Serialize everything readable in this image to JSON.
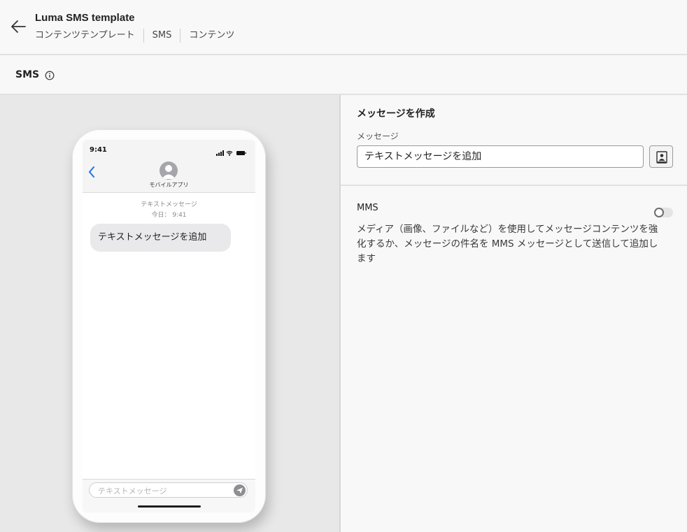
{
  "header": {
    "title": "Luma SMS template",
    "breadcrumbs": [
      "コンテンツテンプレート",
      "SMS",
      "コンテンツ"
    ]
  },
  "subheader": {
    "title": "SMS"
  },
  "preview": {
    "status_time": "9:41",
    "contact_name": "モバイルアプリ",
    "message_label": "テキストメッセージ",
    "message_time": "今日： 9:41",
    "bubble_text": "テキストメッセージを追加",
    "input_placeholder": "テキストメッセージ"
  },
  "panel": {
    "section_title": "メッセージを作成",
    "message_field_label": "メッセージ",
    "message_field_value": "テキストメッセージを追加",
    "mms_label": "MMS",
    "mms_enabled": false,
    "mms_description": "メディア（画像、ファイルなど）を使用してメッセージコンテンツを強化するか、メッセージの件名を MMS メッセージとして送信して追加します"
  },
  "colors": {
    "ios_blue": "#1a73e8",
    "bubble_gray": "#e9e9eb",
    "preview_bg": "#e8e8e8"
  },
  "icons": {
    "back": "arrow-left-icon",
    "info": "info-icon",
    "personalize": "personalization-icon",
    "send": "send-icon"
  }
}
